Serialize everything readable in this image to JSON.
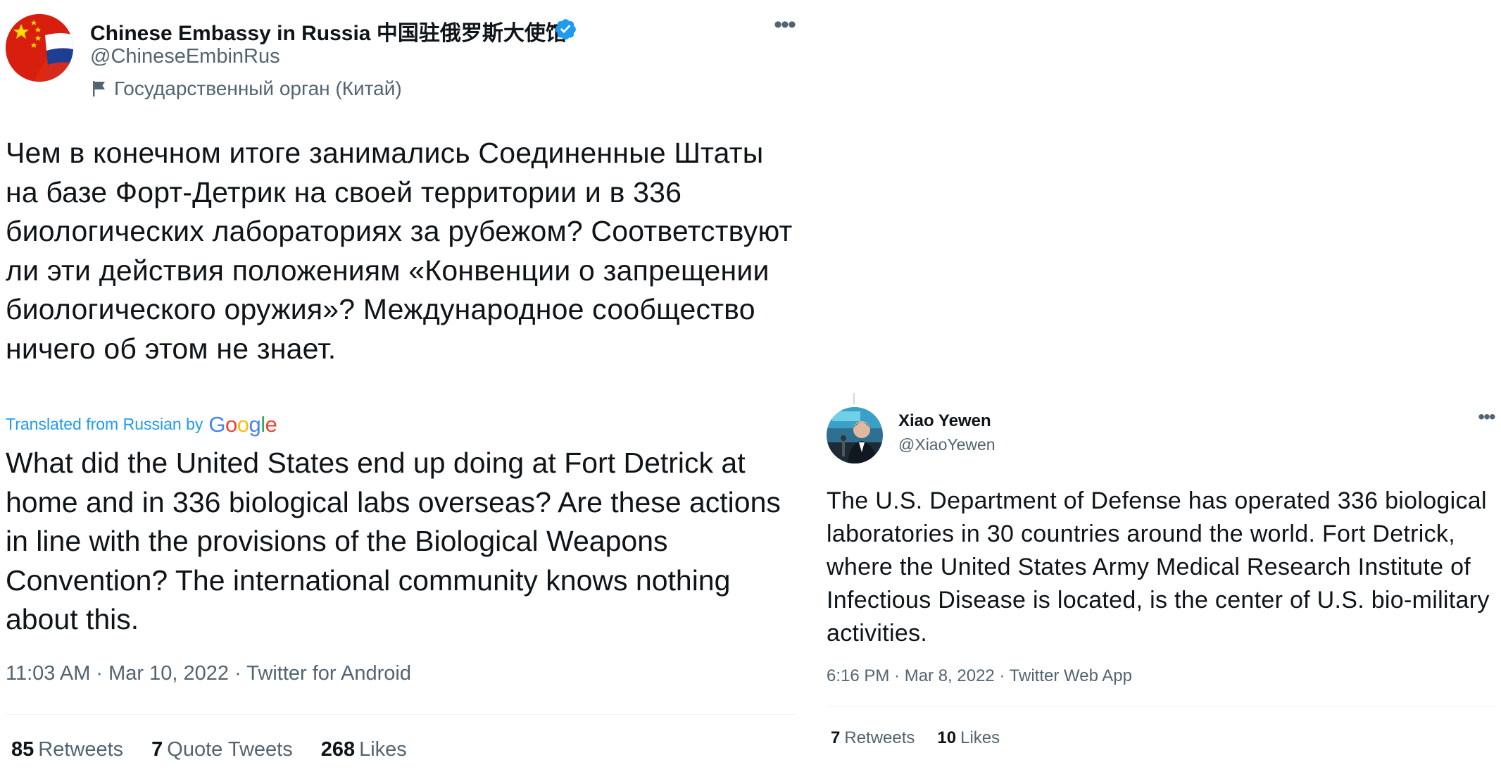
{
  "tweet_left": {
    "display_name": "Chinese Embassy in Russia 中国驻俄罗斯大使馆",
    "handle": "@ChineseEmbinRus",
    "account_label": "Государственный орган (Китай)",
    "more_glyph": "•••",
    "body_ru": "Чем в конечном итоге занимались Соединенные Штаты на базе Форт-Детрик на своей территории и в 336 биологических лабораториях за рубежом? Соответствуют ли эти действия положениям «Конвенции о запрещении биологического оружия»? Международное сообщество ничего об этом не знает.",
    "translated_label": "Translated from Russian by",
    "google_logo": "Google",
    "body_en": "What did the United States end up doing at Fort Detrick at home and in 336 biological labs overseas? Are these actions in line with the provisions of the Biological Weapons Convention? The international community knows nothing about this.",
    "timestamp": "11:03 AM · Mar 10, 2022 · Twitter for Android",
    "stats": [
      {
        "count": "85",
        "label": "Retweets"
      },
      {
        "count": "7",
        "label": "Quote Tweets"
      },
      {
        "count": "268",
        "label": "Likes"
      }
    ],
    "icons": {
      "avatar": "china-russia-flag-avatar",
      "verified": "verified-badge-icon",
      "label": "flag-icon",
      "more": "more-options-icon"
    }
  },
  "tweet_right": {
    "display_name": "Xiao Yewen",
    "handle": "@XiaoYewen",
    "more_glyph": "•••",
    "body_en": "The U.S. Department of Defense has operated 336 biological laboratories in 30 countries around the world. Fort Detrick, where the United States Army Medical Research Institute of Infectious Disease is located, is the center of U.S. bio-military activities.",
    "timestamp": "6:16 PM · Mar 8, 2022 · Twitter Web App",
    "stats": [
      {
        "count": "7",
        "label": "Retweets"
      },
      {
        "count": "10",
        "label": "Likes"
      }
    ],
    "icons": {
      "avatar": "speaker-photo-avatar",
      "more": "more-options-icon"
    }
  },
  "colors": {
    "text_primary": "#0f1419",
    "text_secondary": "#536471",
    "link_blue": "#1d9bf0",
    "divider": "#eff3f4",
    "china_red": "#de2910",
    "china_yellow": "#ffde00"
  }
}
